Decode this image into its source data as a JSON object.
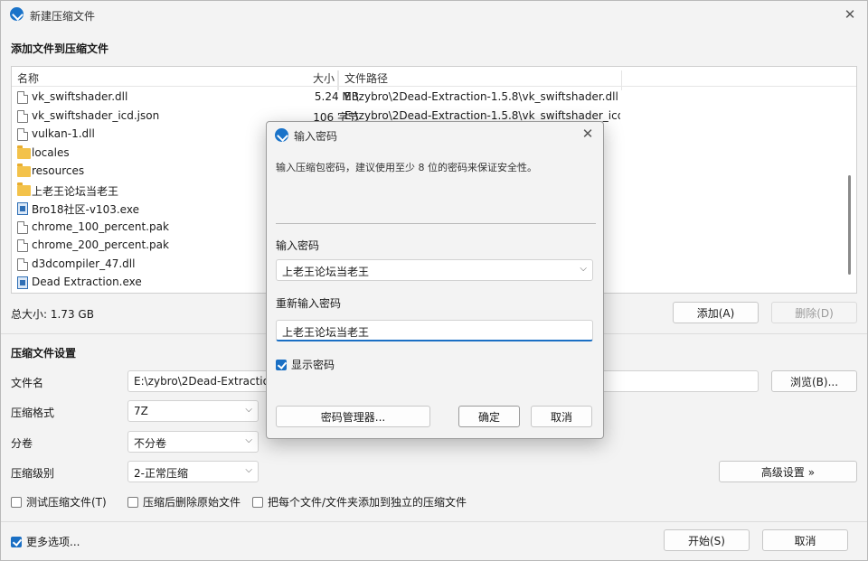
{
  "window": {
    "title": "新建压缩文件"
  },
  "files_section": {
    "title": "添加文件到压缩文件"
  },
  "file_list": {
    "columns": {
      "name": "名称",
      "size": "大小",
      "path": "文件路径"
    },
    "rows": [
      {
        "name": "vk_swiftshader.dll",
        "size": "5.24 MB",
        "path": "E:\\zybro\\2Dead-Extraction-1.5.8\\vk_swiftshader.dll",
        "icon": "file-icon"
      },
      {
        "name": "vk_swiftshader_icd.json",
        "size": "106 字节",
        "path": "E:\\zybro\\2Dead-Extraction-1.5.8\\vk_swiftshader_icd.json",
        "icon": "file-icon"
      },
      {
        "name": "vulkan-1.dll",
        "size": "",
        "path": "",
        "icon": "file-icon"
      },
      {
        "name": "locales",
        "size": "",
        "path": "",
        "icon": "folder-icon"
      },
      {
        "name": "resources",
        "size": "",
        "path": "",
        "icon": "folder-icon"
      },
      {
        "name": "上老王论坛当老王",
        "size": "",
        "path": "",
        "icon": "folder-icon"
      },
      {
        "name": "Bro18社区-v103.exe",
        "size": "",
        "path": "",
        "icon": "exe-icon"
      },
      {
        "name": "chrome_100_percent.pak",
        "size": "",
        "path": "",
        "icon": "file-icon"
      },
      {
        "name": "chrome_200_percent.pak",
        "size": "",
        "path": "",
        "icon": "file-icon"
      },
      {
        "name": "d3dcompiler_47.dll",
        "size": "",
        "path": "",
        "icon": "file-icon"
      },
      {
        "name": "Dead Extraction.exe",
        "size": "",
        "path": "",
        "icon": "exe-icon"
      }
    ]
  },
  "total_size": "总大小: 1.73 GB",
  "buttons": {
    "add": "添加(A)",
    "delete": "删除(D)",
    "browse": "浏览(B)...",
    "advanced": "高级设置 »",
    "start": "开始(S)",
    "cancel": "取消"
  },
  "settings": {
    "title": "压缩文件设置",
    "filename_label": "文件名",
    "filename_value": "E:\\zybro\\2Dead-Extraction",
    "format_label": "压缩格式",
    "format_value": "7Z",
    "split_label": "分卷",
    "split_value": "不分卷",
    "level_label": "压缩级别",
    "level_value": "2-正常压缩"
  },
  "options": {
    "test": "测试压缩文件(T)",
    "delete_source": "压缩后删除原始文件",
    "separate": "把每个文件/文件夹添加到独立的压缩文件",
    "more": "更多选项..."
  },
  "dialog": {
    "title": "输入密码",
    "info": "输入压缩包密码，建议使用至少 8 位的密码来保证安全性。",
    "password_label": "输入密码",
    "password_value": "上老王论坛当老王",
    "confirm_label": "重新输入密码",
    "confirm_value": "上老王论坛当老王",
    "show_password": "显示密码",
    "manager_button": "密码管理器...",
    "ok_button": "确定",
    "cancel_button": "取消"
  },
  "colors": {
    "accent": "#1a6fc4",
    "folder": "#f3c24a"
  }
}
